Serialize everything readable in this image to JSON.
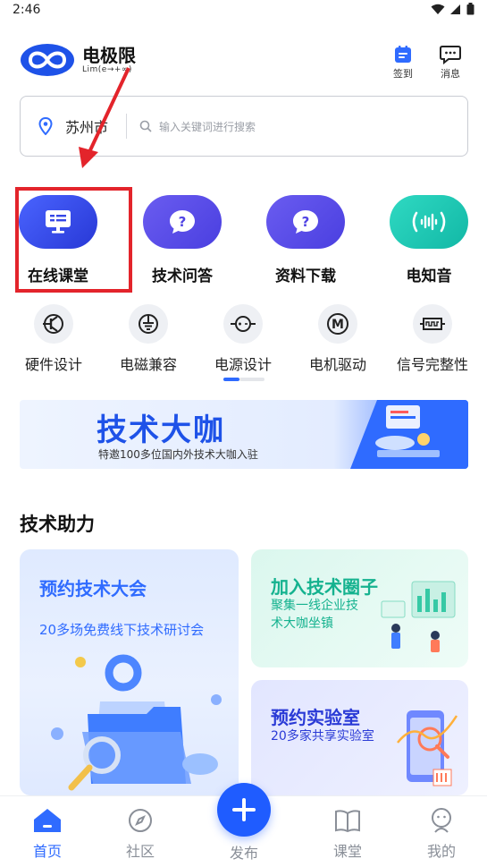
{
  "status": {
    "time": "2:46"
  },
  "header": {
    "logo_name": "电极限",
    "logo_sub": "Lim(e→+∞)",
    "checkin_label": "签到",
    "messages_label": "消息"
  },
  "search": {
    "city": "苏州市",
    "placeholder": "输入关键词进行搜索"
  },
  "features": [
    {
      "label": "在线课堂",
      "icon": "monitor-icon",
      "color": "#3c4fe8"
    },
    {
      "label": "技术问答",
      "icon": "question-chat-icon",
      "color": "#5a4ee6"
    },
    {
      "label": "资料下载",
      "icon": "question-chat-icon",
      "color": "#5a4ee6"
    },
    {
      "label": "电知音",
      "icon": "sound-wave-icon",
      "color": "#22c9b4"
    }
  ],
  "categories": [
    {
      "label": "硬件设计",
      "icon": "transistor-icon"
    },
    {
      "label": "电磁兼容",
      "icon": "ground-icon"
    },
    {
      "label": "电源设计",
      "icon": "power-source-icon"
    },
    {
      "label": "电机驱动",
      "icon": "motor-icon"
    },
    {
      "label": "信号完整性",
      "icon": "signal-icon"
    }
  ],
  "banner": {
    "title": "技术大咖",
    "subtitle": "特邀100多位国内外技术大咖入驻"
  },
  "section": {
    "title": "技术助力"
  },
  "cards": {
    "conference": {
      "title": "预约技术大会",
      "subtitle": "20多场免费线下技术研讨会"
    },
    "circle": {
      "title": "加入技术圈子",
      "subtitle": "聚集一线企业技术大咖坐镇"
    },
    "lab": {
      "title": "预约实验室",
      "subtitle": "20多家共享实验室"
    }
  },
  "nav": {
    "home": "首页",
    "community": "社区",
    "publish": "发布",
    "classroom": "课堂",
    "mine": "我的"
  },
  "colors": {
    "accent": "#2f6bff",
    "annotation": "#e3242b"
  }
}
